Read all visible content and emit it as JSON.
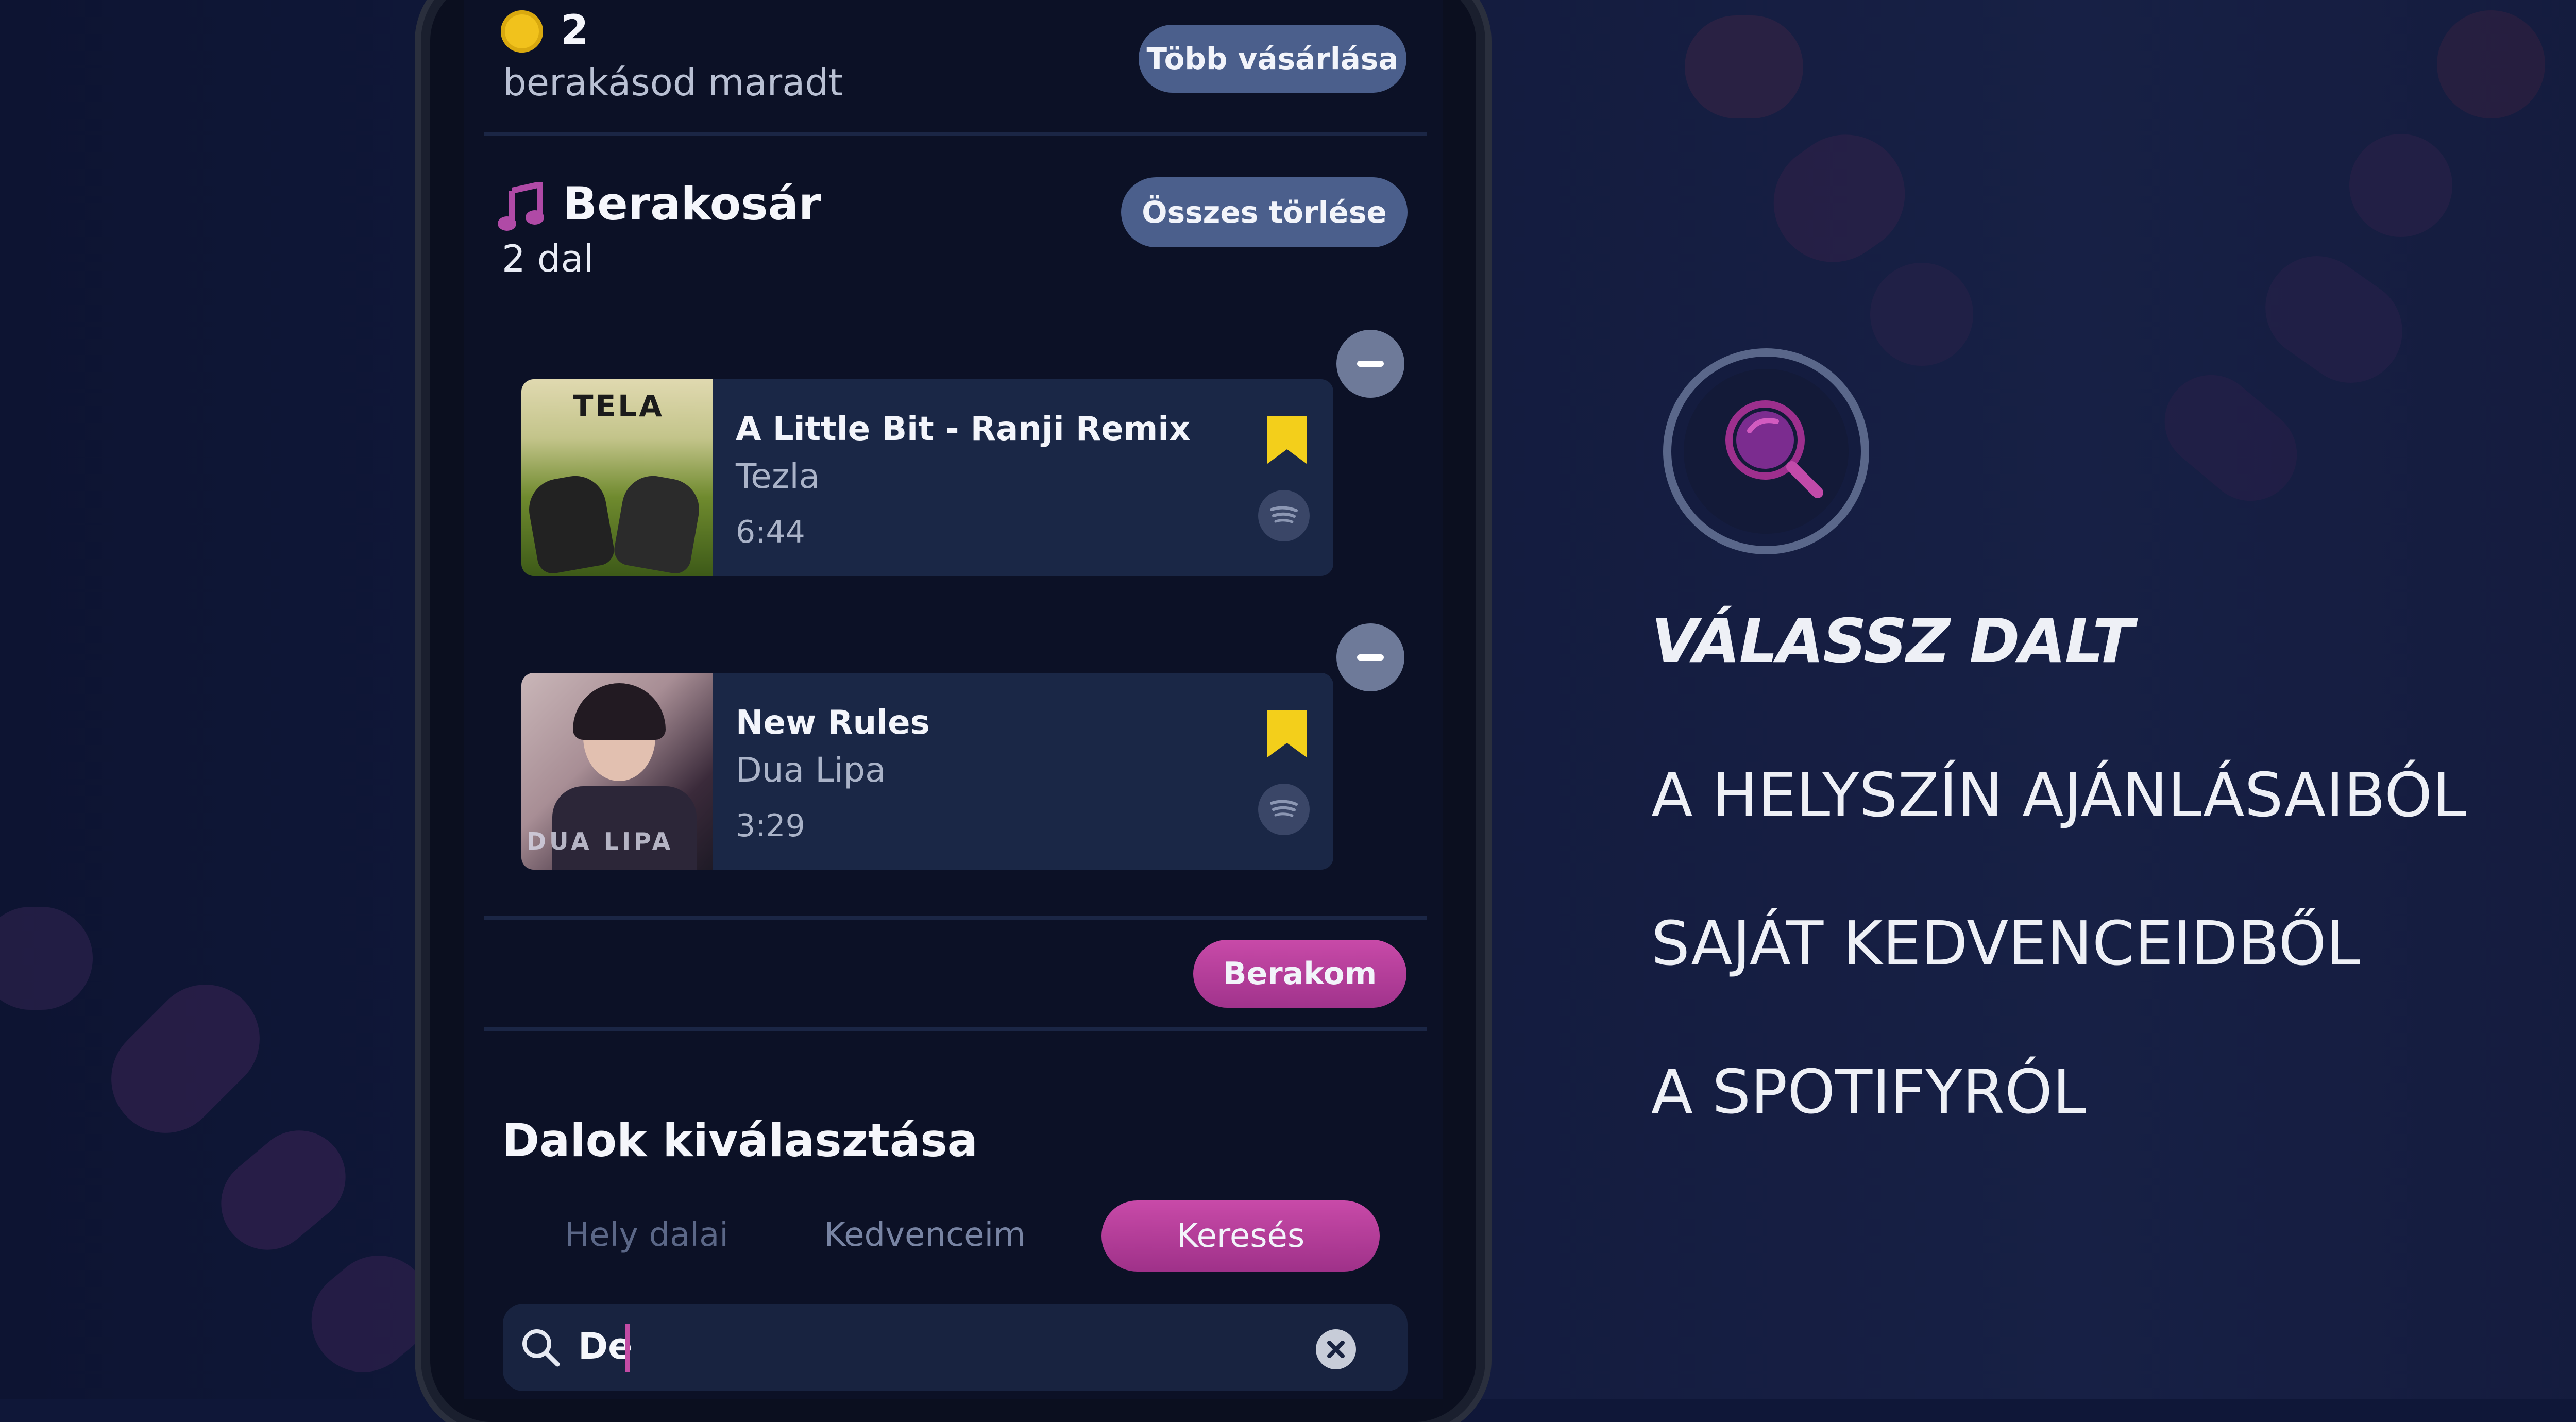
{
  "credits": {
    "count": "2",
    "label": "berakásod maradt",
    "buy_more_label": "Több vásárlása"
  },
  "basket": {
    "title": "Berakosár",
    "count_label": "2 dal",
    "clear_all_label": "Összes törlése",
    "songs": [
      {
        "title": "A Little Bit - Ranji Remix",
        "artist": "Tezla",
        "duration": "6:44",
        "art_text": "TELA"
      },
      {
        "title": "New Rules",
        "artist": "Dua Lipa",
        "duration": "3:29",
        "art_text": "DUA LIPA"
      }
    ],
    "submit_label": "Berakom"
  },
  "song_select": {
    "title": "Dalok kiválasztása",
    "tabs": [
      "Hely dalai",
      "Kedvenceim",
      "Keresés"
    ],
    "active_tab": "Keresés"
  },
  "search": {
    "value": "De"
  },
  "promo": {
    "headline": "VÁLASSZ DALT",
    "lines": [
      "A HELYSZÍN AJÁNLÁSAIBÓL",
      "SAJÁT KEDVENCEIDBŐL",
      "A SPOTIFYRÓL"
    ]
  },
  "colors": {
    "accent_pink": "#c0409c",
    "pill_blue": "#4b5f8c",
    "bookmark_yellow": "#f3cf1b",
    "coin_yellow": "#f1c21c",
    "background_navy": "#0f1738"
  }
}
